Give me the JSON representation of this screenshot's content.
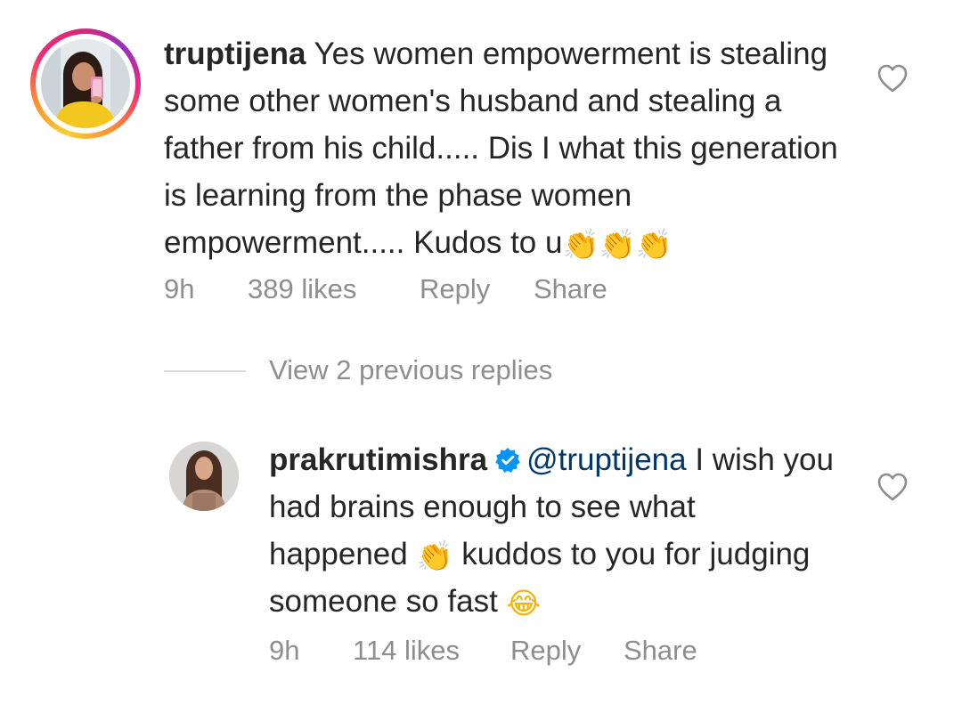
{
  "comments": [
    {
      "username": "truptijena",
      "text": "Yes women empowerment is stealing some other women's husband and stealing a father from his child..... Dis I what this generation is learning from the phase women empowerment..... Kudos to u",
      "trailing_emoji": "👏👏👏",
      "time": "9h",
      "likes": "389 likes",
      "reply_label": "Reply",
      "share_label": "Share",
      "like_icon": "heart-outline-icon"
    },
    {
      "username": "prakrutimishra",
      "verified_icon": "verified-badge-icon",
      "mention": "@truptijena",
      "text_part1": "I wish you had brains enough to see what happened",
      "emoji_1": "👏",
      "text_part2": "kuddos to you for judging someone so fast",
      "emoji_2": "😂",
      "time": "9h",
      "likes": "114 likes",
      "reply_label": "Reply",
      "share_label": "Share",
      "like_icon": "heart-outline-icon"
    }
  ],
  "view_replies_label": "View 2 previous replies",
  "colors": {
    "text": "#262626",
    "secondary": "#8e8e8e",
    "mention": "#00376b",
    "verified": "#0095f6",
    "divider": "#dbdbdb"
  }
}
